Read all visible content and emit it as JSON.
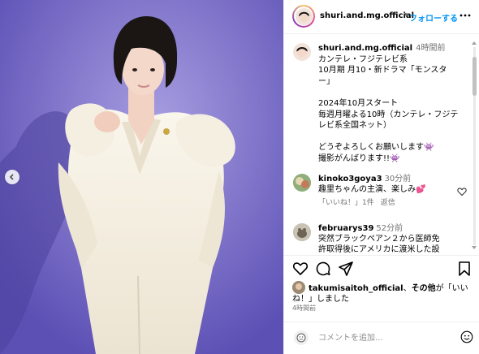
{
  "header": {
    "username": "shuri.and.mg.official",
    "separator": "•",
    "follow_label": "フォローする",
    "more_icon": "ellipsis-icon"
  },
  "caption": {
    "username": "shuri.and.mg.official",
    "time": "4時間前",
    "lines": [
      "カンテレ・フジテレビ系",
      "10月期 月10・新ドラマ「モンスタ",
      "ー」",
      "",
      "2024年10月スタート",
      "毎週月曜よる10時（カンテレ・フジテ",
      "レビ系全国ネット）",
      "",
      "どうぞよろしくお願いします👾",
      "撮影がんばります!!👾"
    ]
  },
  "comments": [
    {
      "username": "kinoko3goya3",
      "time": "30分前",
      "text": "趣里ちゃんの主演、楽しみ💕",
      "likes_label": "「いいね！」1件",
      "reply_label": "返信"
    },
    {
      "username": "februarys39",
      "time": "52分前",
      "text_line1": "突然ブラックペアン２から医師免",
      "text_line2": "許取得後にアメリカに渡米した設"
    }
  ],
  "likes": {
    "username": "takumisaitoh_official",
    "sep": "、",
    "others": "その他",
    "suffix": "が「いいね！」しました"
  },
  "post_time": "4時間前",
  "comment_input": {
    "placeholder": "コメントを追加..."
  },
  "colors": {
    "accent": "#0095f6",
    "secondary_text": "#737373",
    "border": "#efefef",
    "background_purple": "#7e72c8"
  }
}
